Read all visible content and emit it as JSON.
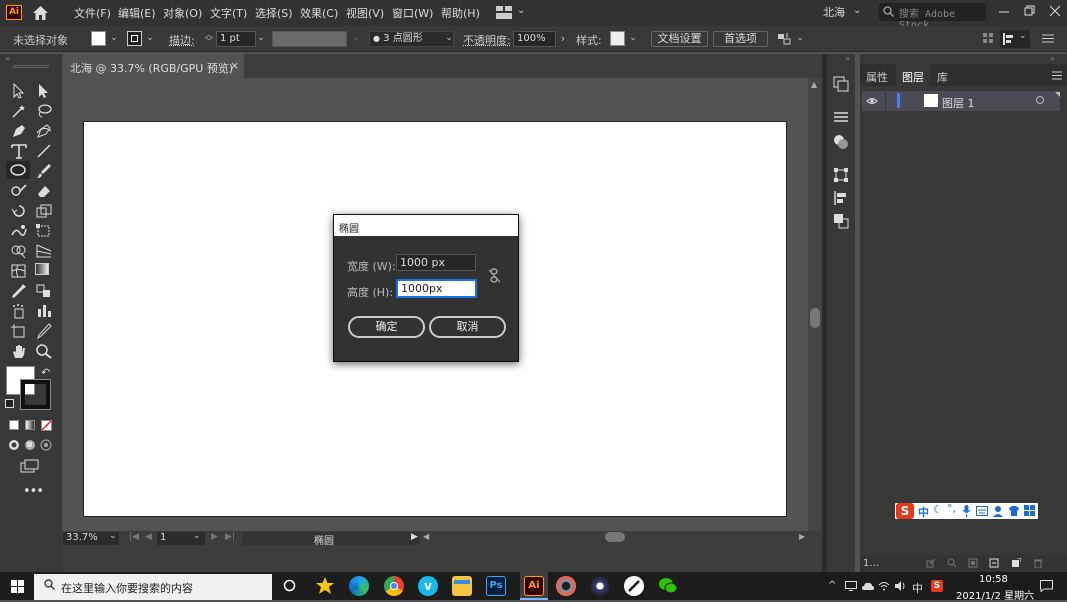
{
  "app": {
    "logo": "Ai"
  },
  "menu": [
    "文件(F)",
    "编辑(E)",
    "对象(O)",
    "文字(T)",
    "选择(S)",
    "效果(C)",
    "视图(V)",
    "窗口(W)",
    "帮助(H)"
  ],
  "workspace": {
    "name": "北海",
    "search_placeholder": "搜索 Adobe Stock"
  },
  "control": {
    "selection": "未选择对象",
    "stroke_label": "描边:",
    "stroke_value": "1 pt",
    "brush": "3 点圆形",
    "opacity_label": "不透明度:",
    "opacity_value": "100%",
    "style_label": "样式:",
    "doc_setup": "文档设置",
    "prefs": "首选项"
  },
  "document": {
    "tab_label": "北海 @ 33.7% (RGB/GPU 预览)",
    "close": "×"
  },
  "status": {
    "zoom": "33.7%",
    "page": "1",
    "tool": "椭圆"
  },
  "dialog": {
    "title": "椭圆",
    "width_label": "宽度 (W):",
    "width_value": "1000 px",
    "height_label": "高度 (H):",
    "height_value": "1000px",
    "ok": "确定",
    "cancel": "取消"
  },
  "panel": {
    "tabs": [
      "属性",
      "图层",
      "库"
    ],
    "active_tab": "图层",
    "layer_name": "图层 1",
    "layer_count": "1..."
  },
  "ime": {
    "label": "中"
  },
  "taskbar": {
    "search_placeholder": "在这里输入你要搜索的内容",
    "tray_lang": "中",
    "time": "10:58",
    "date": "2021/1/2 星期六"
  },
  "colors": {
    "accent": "#1473e6",
    "ai_orange": "#ff9a00",
    "layer_blue": "#4f7cff"
  }
}
